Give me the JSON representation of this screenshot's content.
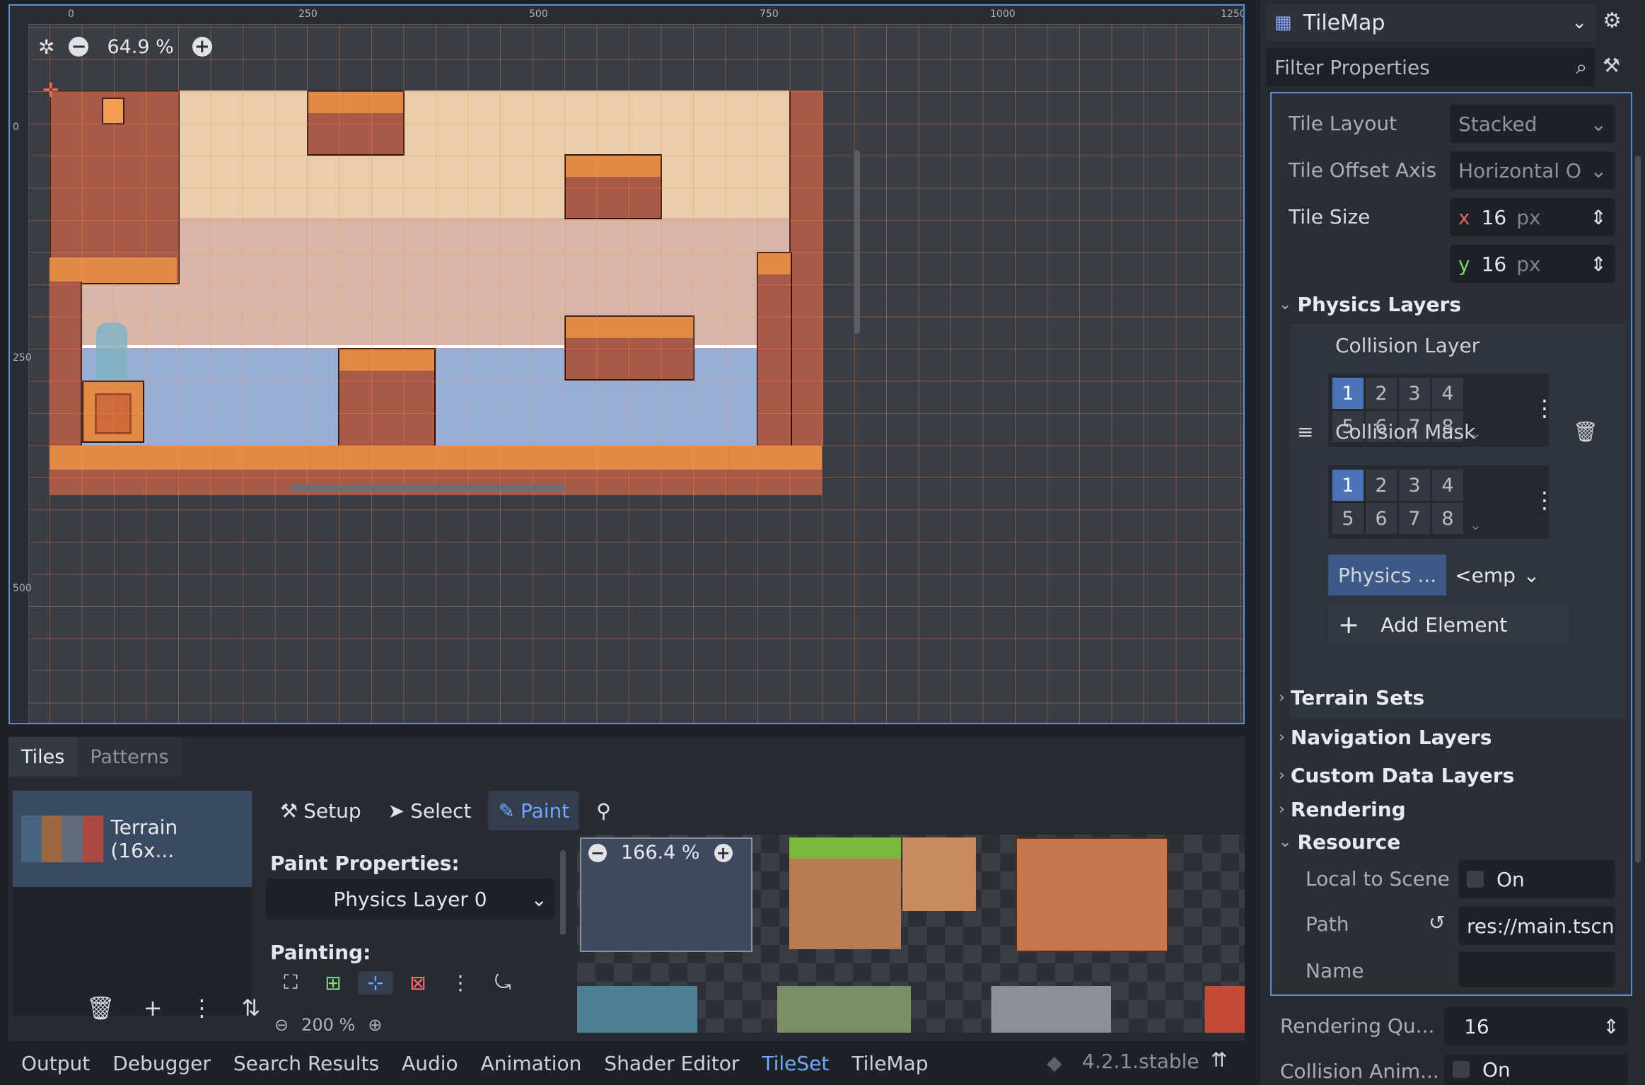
{
  "viewport": {
    "zoom": "64.9 %",
    "ruler_h": [
      "0",
      "250",
      "500",
      "750",
      "1000",
      "1250"
    ],
    "ruler_v": [
      "0",
      "250",
      "500"
    ]
  },
  "bottom_panel": {
    "tabs": [
      "Tiles",
      "Patterns"
    ],
    "tileset_source": "Terrain (16x...",
    "toolbar": {
      "setup": "Setup",
      "select": "Select",
      "paint": "Paint"
    },
    "paint_properties_label": "Paint Properties:",
    "physics_layer_select": "Physics Layer 0",
    "painting_label": "Painting:",
    "atlas_zoom": "166.4 %",
    "small_zoom": "200 %"
  },
  "status_bar": {
    "tabs": [
      "Output",
      "Debugger",
      "Search Results",
      "Audio",
      "Animation",
      "Shader Editor",
      "TileSet",
      "TileMap"
    ],
    "active_tab": "TileSet",
    "version": "4.2.1.stable"
  },
  "inspector": {
    "node_name": "TileMap",
    "filter_placeholder": "Filter Properties",
    "tile_layout_label": "Tile Layout",
    "tile_layout_value": "Stacked",
    "tile_offset_axis_label": "Tile Offset Axis",
    "tile_offset_axis_value": "Horizontal O",
    "tile_size_label": "Tile Size",
    "tile_size_x": "16",
    "tile_size_y": "16",
    "x_label": "x",
    "y_label": "y",
    "px_unit": "px",
    "physics_layers_label": "Physics Layers",
    "collision_layer_label": "Collision Layer",
    "collision_mask_label": "Collision Mask",
    "layer_numbers": [
      "1",
      "2",
      "3",
      "4",
      "5",
      "6",
      "7",
      "8"
    ],
    "physics_material_label": "Physics ...",
    "physics_material_value": "<emp",
    "add_element_label": "Add Element",
    "terrain_sets_label": "Terrain Sets",
    "navigation_layers_label": "Navigation Layers",
    "custom_data_layers_label": "Custom Data Layers",
    "rendering_label": "Rendering",
    "resource_label": "Resource",
    "local_to_scene_label": "Local to Scene",
    "local_to_scene_value": "On",
    "path_label": "Path",
    "path_value": "res://main.tscn",
    "name_label": "Name",
    "rendering_quadrant_label": "Rendering Qu...",
    "rendering_quadrant_value": "16",
    "collision_anim_label": "Collision Anim...",
    "collision_anim_value": "On"
  }
}
